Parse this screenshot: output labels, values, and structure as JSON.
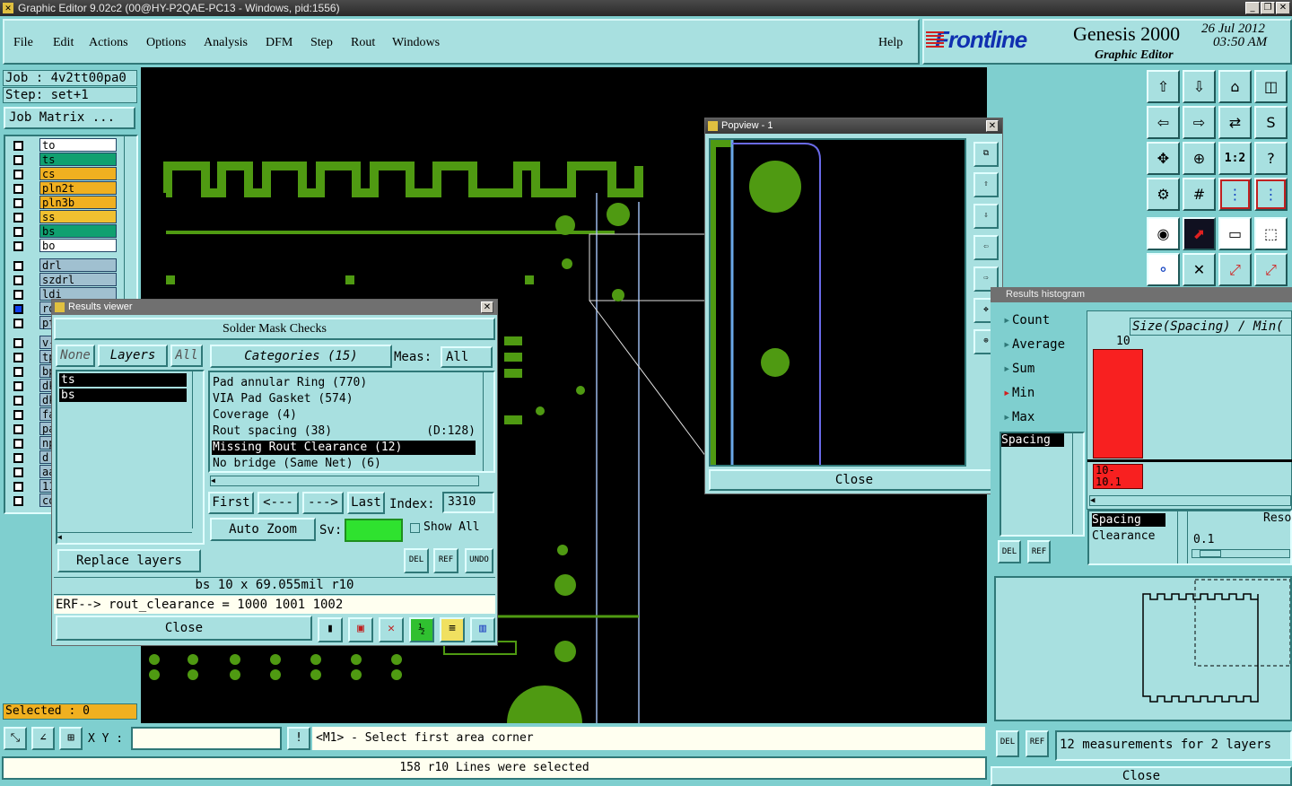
{
  "window": {
    "title": "Graphic Editor 9.02c2 (00@HY-P2QAE-PC13 - Windows, pid:1556)"
  },
  "menu": {
    "file": "File",
    "edit": "Edit",
    "actions": "Actions",
    "options": "Options",
    "analysis": "Analysis",
    "dfm": "DFM",
    "step": "Step",
    "rout": "Rout",
    "windows": "Windows",
    "help": "Help"
  },
  "brand": {
    "logo": "Frontline",
    "product": "Genesis 2000",
    "subtitle": "Graphic Editor",
    "date": "26 Jul 2012",
    "time": "03:50 AM"
  },
  "job": {
    "job": "Job : 4v2tt00pa0",
    "step": "Step: set+1",
    "matrix_button": "Job Matrix ..."
  },
  "layers": [
    {
      "name": "to",
      "color": "#ffffff"
    },
    {
      "name": "ts",
      "color": "#10a070"
    },
    {
      "name": "cs",
      "color": "#f0b020"
    },
    {
      "name": "pln2t",
      "color": "#f0b020"
    },
    {
      "name": "pln3b",
      "color": "#f0b020"
    },
    {
      "name": "ss",
      "color": "#f0c030"
    },
    {
      "name": "bs",
      "color": "#10a070"
    },
    {
      "name": "bo",
      "color": "#ffffff"
    },
    {
      "name": "drl",
      "color": "#a0c0d0"
    },
    {
      "name": "szdrl",
      "color": "#a0c0d0"
    },
    {
      "name": "ldi",
      "color": "#a0c0d0"
    },
    {
      "name": "ro",
      "color": "#a0c0d0"
    },
    {
      "name": "pt",
      "color": "#a0c0d0"
    },
    {
      "name": "v-",
      "color": "#a0c0d0"
    },
    {
      "name": "tp",
      "color": "#a0c0d0"
    },
    {
      "name": "bp",
      "color": "#a0c0d0"
    },
    {
      "name": "dk",
      "color": "#a0c0d0"
    },
    {
      "name": "dk",
      "color": "#a0c0d0"
    },
    {
      "name": "fa",
      "color": "#a0c0d0"
    },
    {
      "name": "pa",
      "color": "#a0c0d0"
    },
    {
      "name": "np",
      "color": "#a0c0d0"
    },
    {
      "name": "d",
      "color": "#a0c0d0"
    },
    {
      "name": "aa",
      "color": "#a0c0d0"
    },
    {
      "name": "11",
      "color": "#a0c0d0"
    },
    {
      "name": "co",
      "color": "#a0c0d0"
    }
  ],
  "selected": "Selected : 0",
  "results_viewer": {
    "title": "Results viewer",
    "heading": "Solder Mask Checks",
    "none": "None",
    "layers": "Layers",
    "all": "All",
    "layer_items": [
      "ts",
      "bs"
    ],
    "categories": "Categories (15)",
    "meas_label": "Meas:",
    "meas_value": "All",
    "category_items": [
      {
        "label": "Pad annular Ring (770)",
        "extra": ""
      },
      {
        "label": "VIA Pad Gasket (574)",
        "extra": ""
      },
      {
        "label": "Coverage (4)",
        "extra": ""
      },
      {
        "label": "Rout spacing (38)",
        "extra": "(D:128)"
      },
      {
        "label": "Missing Rout Clearance (12)",
        "extra": ""
      },
      {
        "label": "No bridge (Same Net) (6)",
        "extra": ""
      }
    ],
    "first": "First",
    "prev": "<---",
    "next": "--->",
    "last": "Last",
    "index_label": "Index:",
    "index_value": "3310",
    "auto_zoom": "Auto Zoom",
    "sv": "Sv:",
    "show_all": "Show All",
    "replace_layers": "Replace layers",
    "del": "DEL",
    "ref": "REF",
    "undo": "UNDO",
    "info": "bs 10 x 69.055mil r10",
    "erf": "ERF--> rout_clearance = 1000 1001 1002",
    "close": "Close"
  },
  "popview": {
    "title": "Popview - 1",
    "close": "Close"
  },
  "histogram": {
    "title": "Results histogram",
    "options": [
      "Count",
      "Average",
      "Sum",
      "Min",
      "Max"
    ],
    "selected_option": "Min",
    "header": "Size(Spacing) / Min(",
    "bar_value": "10",
    "bar_label": "10-\n10.1",
    "list_item": "Spacing",
    "measures": [
      "Spacing",
      "Clearance"
    ],
    "resol_label": "Resol",
    "resol_value": "0.1",
    "summary": "12 measurements for 2 layers",
    "close": "Close",
    "del": "DEL",
    "ref": "REF"
  },
  "bottom": {
    "xy_label": "X Y :",
    "xy_value": "",
    "prompt": "<M1> - Select first area corner",
    "status": "158 r10 Lines were selected"
  }
}
